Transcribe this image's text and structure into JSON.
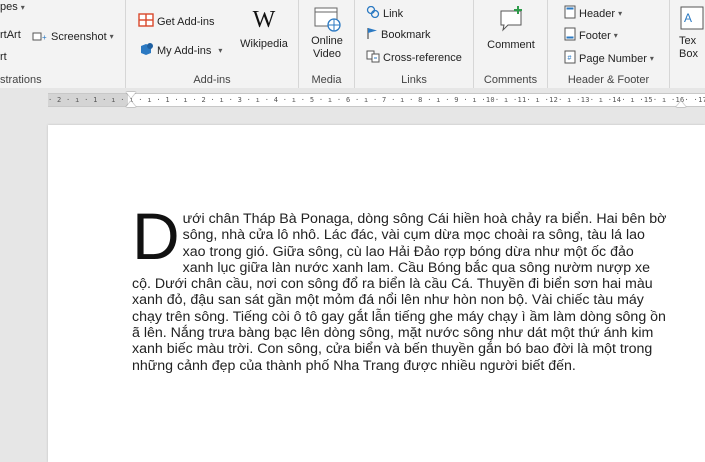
{
  "ribbon": {
    "illustrations": {
      "shapes_partial": "pes",
      "smartart_partial": "rtArt",
      "chart_partial": "rt",
      "screenshot": "Screenshot",
      "label_partial": "strations"
    },
    "addins": {
      "get_addins": "Get Add-ins",
      "my_addins": "My Add-ins",
      "wikipedia": "Wikipedia",
      "label": "Add-ins"
    },
    "media": {
      "online_video_line1": "Online",
      "online_video_line2": "Video",
      "label": "Media"
    },
    "links": {
      "link": "Link",
      "bookmark": "Bookmark",
      "cross_reference": "Cross-reference",
      "label": "Links"
    },
    "comments": {
      "comment": "Comment",
      "label": "Comments"
    },
    "header_footer": {
      "header": "Header",
      "footer": "Footer",
      "page_number": "Page Number",
      "label": "Header & Footer"
    },
    "text": {
      "textbox_line1": "Tex",
      "textbox_line2": "Box"
    }
  },
  "ruler": {
    "marks": "· 2 · ı · 1 · ı ·   ı · ı · 1 · ı · 2 · ı · 3 · ı · 4 · ı · 5 · ı · 6 · ı · 7 · ı · 8 · ı · 9 · ı ·10· ı ·11· ı ·12· ı ·13· ı ·14· ı ·15· ı ·16·   ·17· ı"
  },
  "document": {
    "drop_cap": "D",
    "paragraph": "ưới chân Tháp Bà Ponaga, dòng sông Cái hiền hoà chảy ra biển. Hai bên bờ sông, nhà cửa lô nhô. Lác đác, vài cụm dừa mọc choài ra sông, tàu lá lao xao trong gió. Giữa sông, cù lao Hải Đảo rợp bóng dừa như một ốc đảo xanh lục giữa làn nước xanh lam. Cầu Bóng bắc qua sông nườm nượp xe cộ. Dưới chân cầu, nơi con sông đổ ra biển là cầu Cá. Thuyền đi biển sơn hai màu xanh đỏ, đậu san sát gần một mỏm đá nổi lên như hòn non bộ. Vài chiếc tàu máy chạy trên sông. Tiếng còi ô tô gay gắt lẫn tiếng ghe máy chạy ì ầm làm dòng sông ồn ã lên. Nắng trưa bàng bạc lên dòng sông, mặt nước sông như dát một thứ ánh kim xanh biếc màu trời. Con sông, cửa biển và bến thuyền gắn bó bao đời là một trong những cảnh đẹp của thành phố Nha Trang được nhiều người biết đến."
  }
}
